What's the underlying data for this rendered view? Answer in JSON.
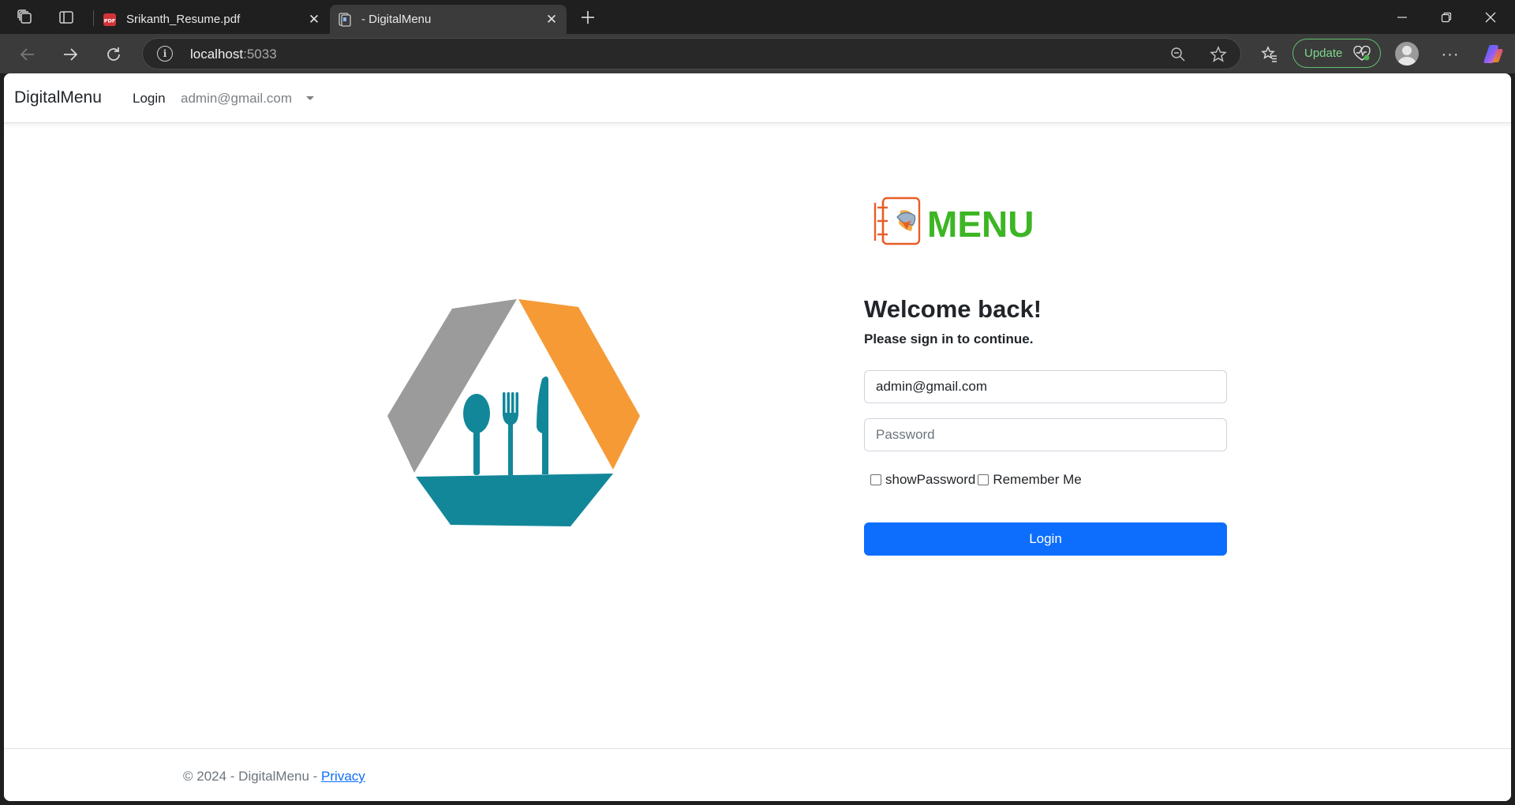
{
  "browser": {
    "tabs": [
      {
        "title": "Srikanth_Resume.pdf",
        "favicon": "pdf-icon",
        "active": false
      },
      {
        "title": "- DigitalMenu",
        "favicon": "page-icon",
        "active": true
      }
    ],
    "url_host": "localhost",
    "url_port": ":5033",
    "update_label": "Update",
    "accent_update": "#5fbf6e"
  },
  "navbar": {
    "brand": "DigitalMenu",
    "login_link": "Login",
    "user_dropdown": "admin@gmail.com"
  },
  "logo": {
    "menu_text": "MENU",
    "menu_color": "#3db524",
    "hex_colors": {
      "gray": "#9b9b9b",
      "orange": "#f59a35",
      "teal": "#12879a"
    }
  },
  "login": {
    "heading": "Welcome back!",
    "subheading": "Please sign in to continue.",
    "email_value": "admin@gmail.com",
    "password_placeholder": "Password",
    "show_password_label": "showPassword",
    "show_password_checked": false,
    "remember_me_label": "Remember Me",
    "remember_me_checked": false,
    "submit_label": "Login",
    "button_color": "#0d6efd"
  },
  "footer": {
    "copyright": "© 2024 - DigitalMenu - ",
    "privacy_link": "Privacy"
  }
}
